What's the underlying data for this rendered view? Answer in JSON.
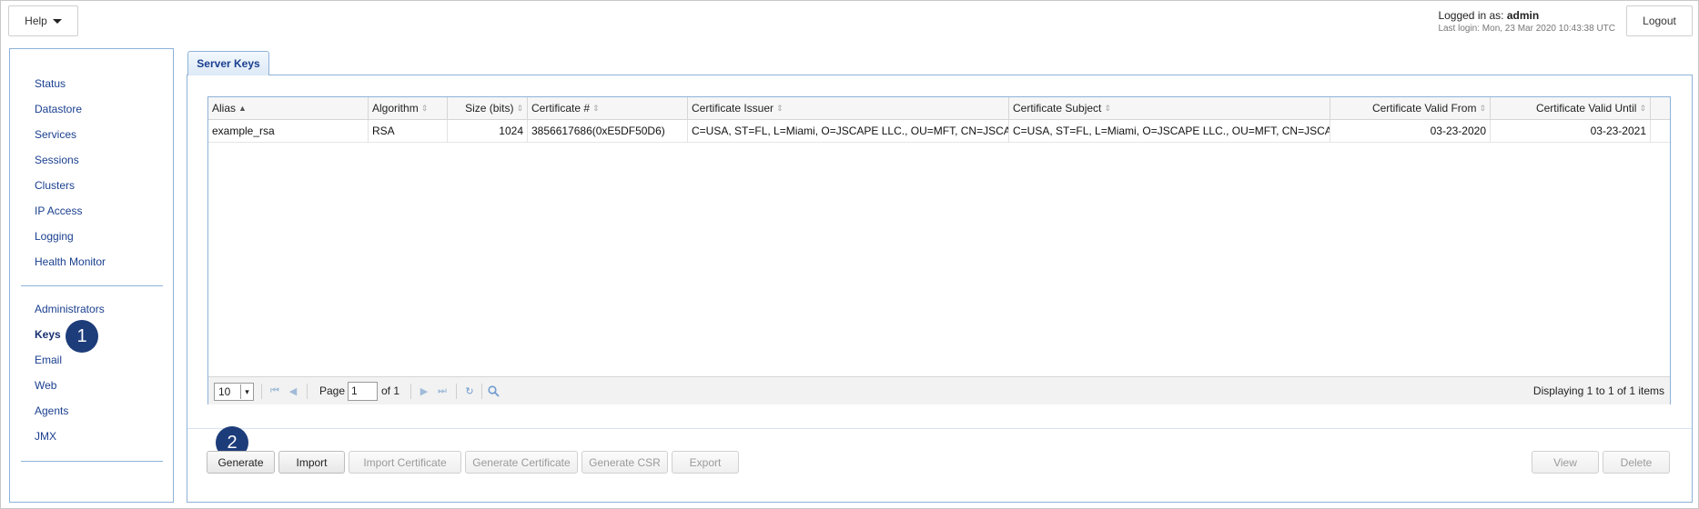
{
  "header": {
    "help_label": "Help",
    "logged_in_prefix": "Logged in as:",
    "username": "admin",
    "last_login": "Last login: Mon, 23 Mar 2020 10:43:38 UTC",
    "logout_label": "Logout"
  },
  "sidebar": {
    "group1": [
      "Status",
      "Datastore",
      "Services",
      "Sessions",
      "Clusters",
      "IP Access",
      "Logging",
      "Health Monitor"
    ],
    "group2": [
      "Administrators",
      "Keys",
      "Email",
      "Web",
      "Agents",
      "JMX"
    ],
    "active": "Keys"
  },
  "badges": {
    "one": "1",
    "two": "2"
  },
  "main": {
    "tab_label": "Server Keys",
    "columns": [
      "Alias",
      "Algorithm",
      "Size (bits)",
      "Certificate #",
      "Certificate Issuer",
      "Certificate Subject",
      "Certificate Valid From",
      "Certificate Valid Until"
    ],
    "rows": [
      {
        "alias": "example_rsa",
        "algorithm": "RSA",
        "size": "1024",
        "cert_number": "3856617686(0xE5DF50D6)",
        "issuer": "C=USA, ST=FL, L=Miami, O=JSCAPE LLC., OU=MFT, CN=JSCAPE",
        "subject": "C=USA, ST=FL, L=Miami, O=JSCAPE LLC., OU=MFT, CN=JSCAPE",
        "valid_from": "03-23-2020",
        "valid_until": "03-23-2021"
      }
    ],
    "pager": {
      "page_size": "10",
      "page_word": "Page",
      "page_value": "1",
      "of_label": "of 1",
      "display_text": "Displaying 1 to 1 of 1 items"
    }
  },
  "actions": {
    "generate": "Generate",
    "import": "Import",
    "import_certificate": "Import Certificate",
    "generate_certificate": "Generate Certificate",
    "generate_csr": "Generate CSR",
    "export": "Export",
    "view": "View",
    "delete": "Delete"
  },
  "colors": {
    "accent": "#8db2d9",
    "badge": "#1d3c7a",
    "link": "#1a3f8f"
  },
  "icons": [
    "caret-down-icon",
    "sort-asc-icon",
    "sort-icon",
    "first-page-icon",
    "prev-page-icon",
    "next-page-icon",
    "last-page-icon",
    "refresh-icon",
    "search-icon"
  ]
}
